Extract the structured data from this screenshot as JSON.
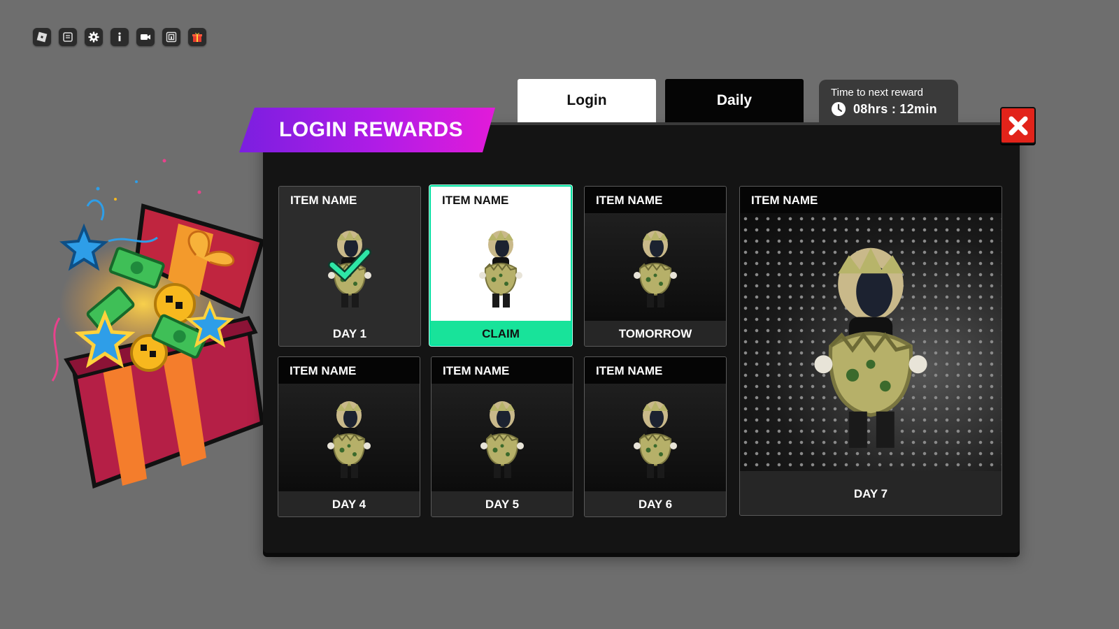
{
  "toolbar": {
    "icons": [
      "roblox-logo-icon",
      "chat-icon",
      "gear-icon",
      "info-icon",
      "camera-icon",
      "emote-icon",
      "gift-icon"
    ]
  },
  "title": "LOGIN REWARDS",
  "tabs": [
    {
      "label": "Login",
      "selected": true
    },
    {
      "label": "Daily",
      "selected": false
    }
  ],
  "timer": {
    "label": "Time to next reward",
    "value": "08hrs  :  12min"
  },
  "rewards": [
    {
      "name": "ITEM NAME",
      "footer": "DAY 1",
      "state": "claimed"
    },
    {
      "name": "ITEM NAME",
      "footer": "CLAIM",
      "state": "available"
    },
    {
      "name": "ITEM NAME",
      "footer": "TOMORROW",
      "state": "locked"
    },
    {
      "name": "ITEM NAME",
      "footer": "DAY 4",
      "state": "locked"
    },
    {
      "name": "ITEM NAME",
      "footer": "DAY 5",
      "state": "locked"
    },
    {
      "name": "ITEM NAME",
      "footer": "DAY 6",
      "state": "locked"
    },
    {
      "name": "ITEM NAME",
      "footer": "DAY 7",
      "state": "featured"
    }
  ],
  "colors": {
    "accent_claim": "#18e39a",
    "banner_start": "#7b1fe0",
    "banner_end": "#e21bd9",
    "close": "#e2231a"
  }
}
